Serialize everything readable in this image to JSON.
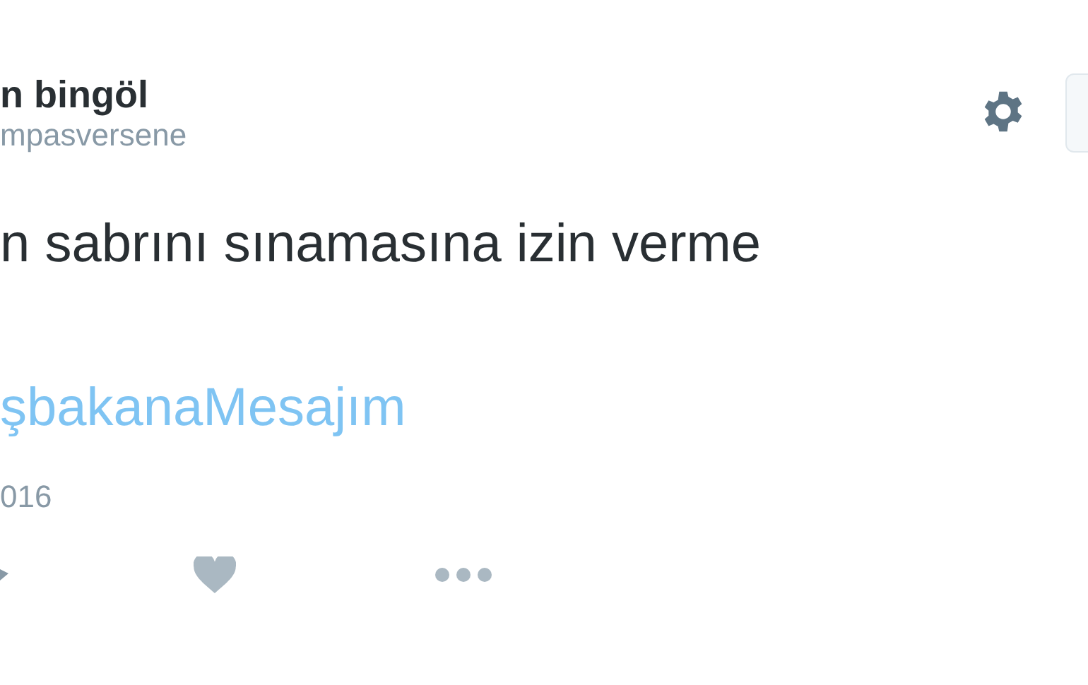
{
  "tweet": {
    "author_name": "n bingöl",
    "handle": "mpasversene",
    "text": "n sabrını sınamasına izin verme",
    "hashtag": "şbakanaMesajım",
    "date": "016",
    "liked": false
  }
}
